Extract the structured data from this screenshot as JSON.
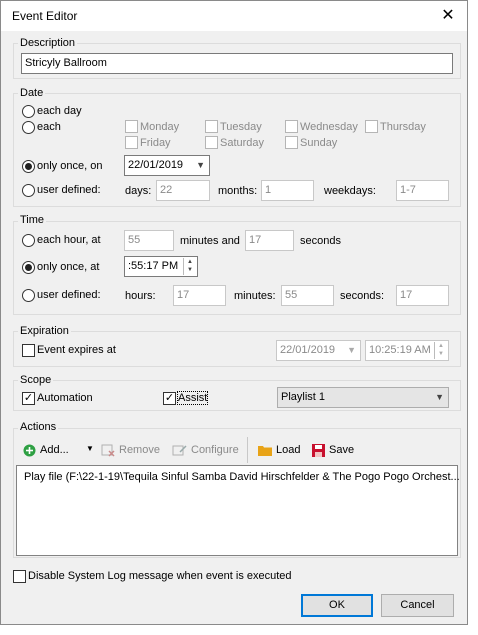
{
  "window": {
    "title": "Event Editor"
  },
  "description": {
    "label": "Description",
    "value": "Stricyly Ballroom"
  },
  "date": {
    "label": "Date",
    "each_day": "each day",
    "each": "each",
    "days": {
      "monday": "Monday",
      "tuesday": "Tuesday",
      "wednesday": "Wednesday",
      "thursday": "Thursday",
      "friday": "Friday",
      "saturday": "Saturday",
      "sunday": "Sunday"
    },
    "only_once": "only once, on",
    "only_once_value": "22/01/2019",
    "user_defined": "user defined:",
    "days_label": "days:",
    "days_value": "22",
    "months_label": "months:",
    "months_value": "1",
    "weekdays_label": "weekdays:",
    "weekdays_value": "1-7",
    "selected": "only_once"
  },
  "time": {
    "label": "Time",
    "each_hour": "each hour, at",
    "each_hour_minutes": "55",
    "minutes_and": "minutes and",
    "each_hour_seconds": "17",
    "seconds": "seconds",
    "only_once": "only once, at",
    "only_once_value": ":55:17 PM",
    "user_defined": "user defined:",
    "hours_label": "hours:",
    "hours_value": "17",
    "minutes_label": "minutes:",
    "minutes_value": "55",
    "seconds_label": "seconds:",
    "seconds_value": "17",
    "selected": "only_once"
  },
  "expiration": {
    "label": "Expiration",
    "checkbox": "Event expires at",
    "date_value": "22/01/2019",
    "time_value": "10:25:19 AM",
    "checked": false
  },
  "scope": {
    "label": "Scope",
    "automation": "Automation",
    "assist": "Assist",
    "playlist": "Playlist 1",
    "automation_checked": true,
    "assist_checked": true
  },
  "actions": {
    "label": "Actions",
    "add": "Add...",
    "remove": "Remove",
    "configure": "Configure",
    "load": "Load",
    "save": "Save",
    "items": [
      "Play file (F:\\22-1-19\\Tequila  Sinful Samba David Hirschfelder & The Pogo Pogo Orchest..."
    ]
  },
  "footer": {
    "disable_log": "Disable System Log message when event is executed",
    "ok": "OK",
    "cancel": "Cancel"
  },
  "colors": {
    "accent": "#0078d7",
    "add_green": "#2ea043",
    "remove_red": "#c0392b",
    "folder": "#e8a317",
    "save_red": "#c8102e"
  }
}
